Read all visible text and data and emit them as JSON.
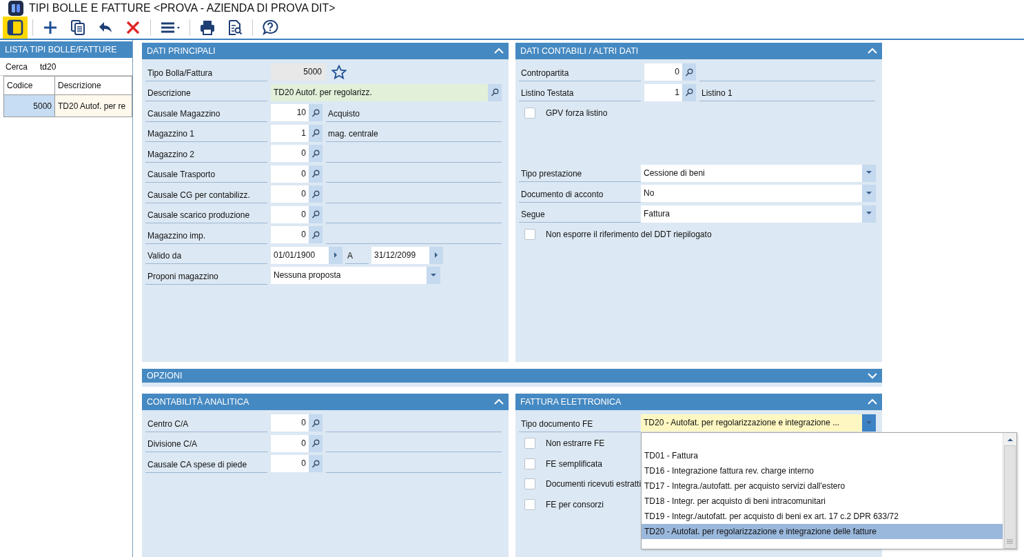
{
  "window": {
    "title": "TIPI BOLLE E FATTURE <PROVA - AZIENDA DI PROVA DIT>"
  },
  "toolbar": {
    "sidebar_toggle_on": true
  },
  "sidebar": {
    "title": "LISTA TIPI BOLLE/FATTURE",
    "search": {
      "label": "Cerca",
      "value": "td20"
    },
    "columns": [
      "Codice",
      "Descrizione"
    ],
    "rows": [
      {
        "cells": [
          "5000",
          "TD20 Autof. per re"
        ],
        "selected": true
      }
    ]
  },
  "panels": [
    {
      "title": "DATI PRINCIPALI",
      "collapsed": false,
      "groups": [
        [
          {
            "kind": "readonly",
            "label": "Tipo Bolla/Fattura",
            "value": "5000",
            "favorite": false
          },
          {
            "kind": "text-search",
            "label": "Descrizione",
            "value": "TD20 Autof. per regolarizz."
          },
          {
            "kind": "lookup",
            "label": "Causale Magazzino",
            "value": "10",
            "text": "Acquisto"
          },
          {
            "kind": "lookup",
            "label": "Magazzino 1",
            "value": "1",
            "text": "mag. centrale"
          },
          {
            "kind": "lookup",
            "label": "Magazzino 2",
            "value": "0"
          },
          {
            "kind": "lookup",
            "label": "Causale Trasporto",
            "value": "0"
          },
          {
            "kind": "lookup",
            "label": "Causale CG per contabilizz.",
            "value": "0"
          },
          {
            "kind": "lookup",
            "label": "Causale scarico produzione",
            "value": "0"
          },
          {
            "kind": "lookup",
            "label": "Magazzino imp.",
            "value": "0"
          },
          {
            "kind": "date-range",
            "label": "Valido da",
            "from": "01/01/1900",
            "separator": "A",
            "to": "31/12/2099"
          },
          {
            "kind": "select",
            "label": "Proponi magazzino",
            "value": "Nessuna proposta",
            "expanded": false
          }
        ]
      ]
    },
    {
      "title": "DATI CONTABILI / ALTRI DATI",
      "collapsed": false,
      "groups": [
        [
          {
            "kind": "lookup",
            "label": "Contropartita",
            "value": "0"
          },
          {
            "kind": "lookup",
            "label": "Listino Testata",
            "value": "1",
            "text": "Listino 1"
          },
          {
            "kind": "checkbox",
            "label": "GPV forza listino",
            "checked": false
          }
        ],
        [
          {
            "kind": "select",
            "label": "Tipo prestazione",
            "value": "Cessione di beni",
            "expanded": false
          },
          {
            "kind": "select",
            "label": "Documento di acconto",
            "value": "No",
            "expanded": false
          },
          {
            "kind": "select",
            "label": "Segue",
            "value": "Fattura",
            "expanded": false
          },
          {
            "kind": "checkbox",
            "label": "Non esporre il riferimento del DDT riepilogato",
            "checked": false
          }
        ]
      ]
    },
    {
      "title": "OPZIONI",
      "collapsed": true
    },
    {
      "title": "CONTABILITÀ ANALITICA",
      "collapsed": false,
      "groups": [
        [
          {
            "kind": "lookup",
            "label": "Centro C/A",
            "value": "0"
          },
          {
            "kind": "lookup",
            "label": "Divisione C/A",
            "value": "0"
          },
          {
            "kind": "lookup",
            "label": "Causale CA spese di piede",
            "value": "0"
          }
        ]
      ]
    },
    {
      "title": "FATTURA ELETTRONICA",
      "collapsed": false,
      "groups": [
        [
          {
            "kind": "select",
            "label": "Tipo documento FE",
            "value": "TD20 - Autofat. per regolarizzazione e integrazione ...",
            "expanded": true,
            "options": [
              {
                "label": "TD01 - Fattura",
                "selected": false
              },
              {
                "label": "TD16 - Integrazione fattura rev. charge interno",
                "selected": false
              },
              {
                "label": "TD17 - Integra./autofatt. per acquisto servizi dall'estero",
                "selected": false
              },
              {
                "label": "TD18 - Integr. per acquisto di beni intracomunitari",
                "selected": false
              },
              {
                "label": "TD19 - Integr./autofatt. per acquisto di beni ex art. 17 c.2 DPR 633/72",
                "selected": false
              },
              {
                "label": "TD20 - Autofat. per regolarizzazione e integrazione delle fatture",
                "selected": true
              }
            ]
          },
          {
            "kind": "checkbox",
            "label": "Non estrarre FE",
            "checked": false
          },
          {
            "kind": "checkbox",
            "label": "FE semplificata",
            "checked": false
          },
          {
            "kind": "checkbox",
            "label": "Documenti ricevuti estratti",
            "checked": false
          },
          {
            "kind": "checkbox",
            "label": "FE per consorzi",
            "checked": false
          }
        ]
      ]
    }
  ]
}
